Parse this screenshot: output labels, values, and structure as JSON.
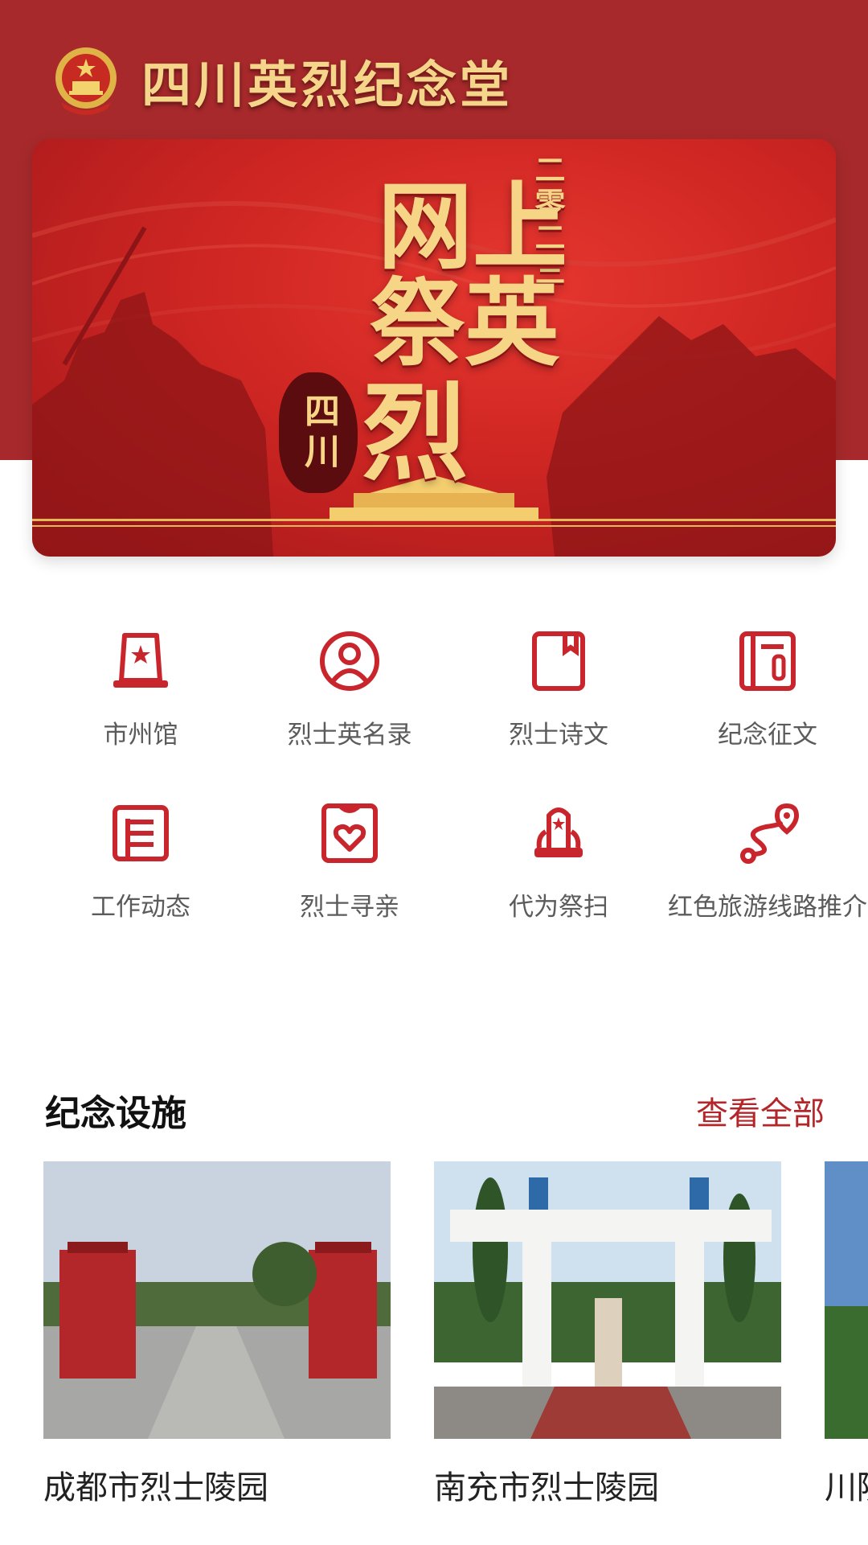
{
  "header": {
    "title": "四川英烈纪念堂",
    "brand_color": "#a7292b",
    "title_color": "#f4d58a",
    "emblem_icon": "national-emblem-icon"
  },
  "banner": {
    "year_text": "二零二三",
    "headline_line1": "网上",
    "headline_line2": "祭英",
    "headline_line3": "烈",
    "seal_text": "四川",
    "accent_gold": "#f6d587"
  },
  "menu": {
    "items": [
      {
        "label": "市州馆",
        "icon": "city-hall-icon"
      },
      {
        "label": "烈士英名录",
        "icon": "person-icon"
      },
      {
        "label": "烈士诗文",
        "icon": "book-icon"
      },
      {
        "label": "纪念征文",
        "icon": "document-edit-icon"
      },
      {
        "label": "工作动态",
        "icon": "news-icon"
      },
      {
        "label": "烈士寻亲",
        "icon": "heart-frame-icon"
      },
      {
        "label": "代为祭扫",
        "icon": "monument-icon"
      },
      {
        "label": "红色旅游线路推介",
        "icon": "route-icon"
      }
    ],
    "icon_color": "#c9252c"
  },
  "facilities": {
    "title": "纪念设施",
    "view_all": "查看全部",
    "cards": [
      {
        "name": "成都市烈士陵园"
      },
      {
        "name": "南充市烈士陵园"
      },
      {
        "name": "川陕"
      }
    ]
  }
}
